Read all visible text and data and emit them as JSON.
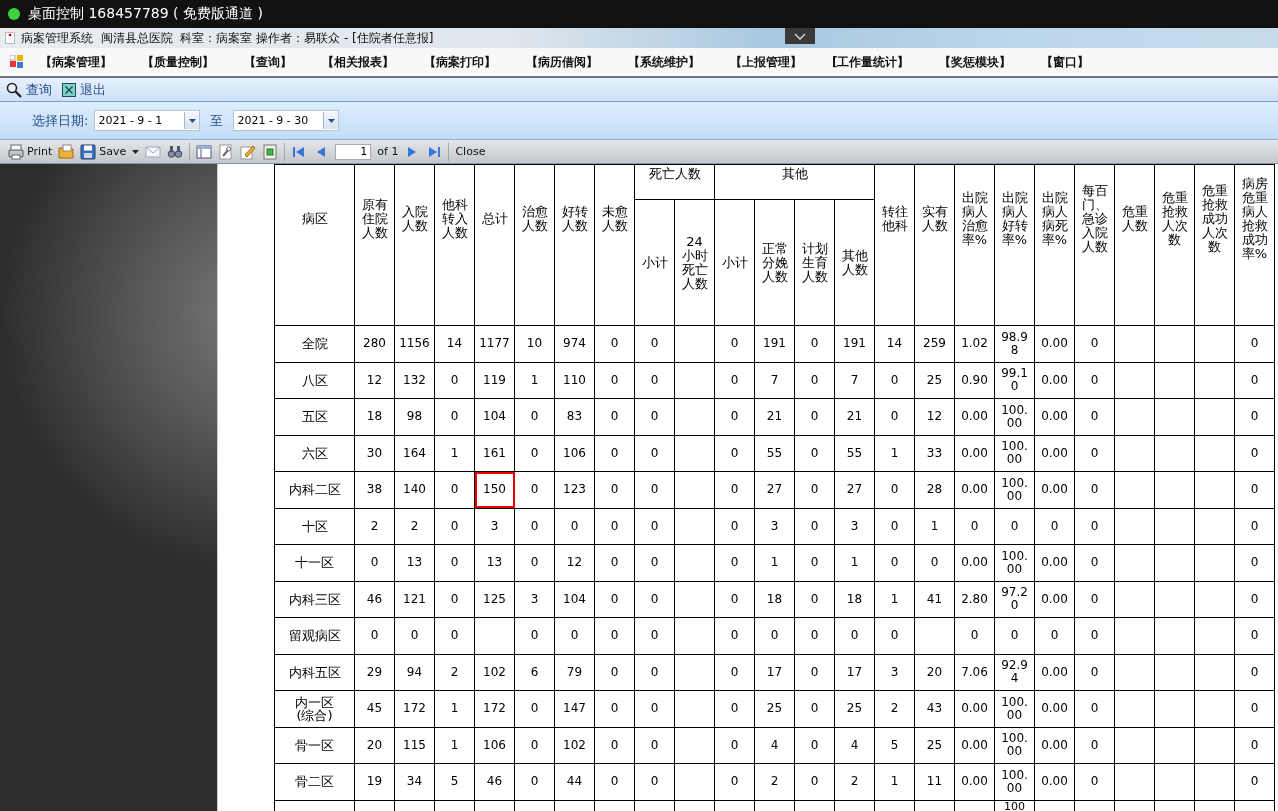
{
  "remote_title": "桌面控制 168457789 ( 免费版通道 )",
  "app_title": "病案管理系统  闽清县总医院  科室：病案室 操作者：易联众 - [住院者任意报]",
  "menu": [
    "【病案管理】",
    "【质量控制】",
    "【查询】",
    "【相关报表】",
    "【病案打印】",
    "【病历借阅】",
    "【系统维护】",
    "【上报管理】",
    "[工作量统计】",
    "【奖惩模块】",
    "【窗口】"
  ],
  "toolbar": [
    {
      "kind": "search",
      "label": "查询"
    },
    {
      "kind": "exit",
      "label": "退出"
    }
  ],
  "date_filter": {
    "label": "选择日期:",
    "from": "2021 - 9 - 1",
    "separator": "至",
    "to": "2021 - 9 - 30"
  },
  "report_toolbar": [
    {
      "kind": "print",
      "label": "Print"
    },
    {
      "kind": "open"
    },
    {
      "kind": "save",
      "label": "Save"
    },
    {
      "kind": "dropdown"
    },
    {
      "kind": "mail"
    },
    {
      "kind": "find"
    },
    {
      "kind": "separator"
    },
    {
      "kind": "layout"
    },
    {
      "kind": "setup"
    },
    {
      "kind": "edit"
    },
    {
      "kind": "export"
    },
    {
      "kind": "separator"
    },
    {
      "kind": "first"
    },
    {
      "kind": "prev"
    },
    {
      "kind": "page",
      "value": "1",
      "total": "of 1"
    },
    {
      "kind": "next"
    },
    {
      "kind": "last"
    },
    {
      "kind": "separator"
    },
    {
      "kind": "close",
      "label": "Close"
    }
  ],
  "table": {
    "header": [
      {
        "label": "病区"
      },
      {
        "label": "原有住院人数"
      },
      {
        "label": "入院人数"
      },
      {
        "label": "他科转入人数"
      },
      {
        "label": "总计"
      },
      {
        "label": "治愈人数"
      },
      {
        "label": "好转人数"
      },
      {
        "label": "未愈人数"
      },
      {
        "label": "死亡人数",
        "children": [
          {
            "label": "小计"
          },
          {
            "label": "24小时死亡人数"
          }
        ]
      },
      {
        "label": "其他",
        "children": [
          {
            "label": "小计"
          },
          {
            "label": "正常分娩人数"
          },
          {
            "label": "计划生育人数"
          },
          {
            "label": "其他人数"
          }
        ]
      },
      {
        "label": "转往他科"
      },
      {
        "label": "实有人数"
      },
      {
        "label": "出院病人治愈率%"
      },
      {
        "label": "出院病人好转率%"
      },
      {
        "label": "出院病人病死率%"
      },
      {
        "label": "每百门、急诊入院人数"
      },
      {
        "label": "危重人数"
      },
      {
        "label": "危重抢救人次数"
      },
      {
        "label": "危重抢救成功人次数"
      },
      {
        "label": "病房危重病人抢救成功率%"
      }
    ],
    "rows": [
      {
        "ward": "全院",
        "cells": [
          "280",
          "1156",
          "14",
          "1177",
          "10",
          "974",
          "0",
          "0",
          null,
          "0",
          "191",
          "0",
          "191",
          "14",
          "259",
          "1.02",
          "98.98",
          "0.00",
          "0",
          null,
          null,
          null,
          "0"
        ]
      },
      {
        "ward": "八区",
        "cells": [
          "12",
          "132",
          "0",
          "119",
          "1",
          "110",
          "0",
          "0",
          null,
          "0",
          "7",
          "0",
          "7",
          "0",
          "25",
          "0.90",
          "99.10",
          "0.00",
          "0",
          null,
          null,
          null,
          "0"
        ]
      },
      {
        "ward": "五区",
        "cells": [
          "18",
          "98",
          "0",
          "104",
          "0",
          "83",
          "0",
          "0",
          null,
          "0",
          "21",
          "0",
          "21",
          "0",
          "12",
          "0.00",
          "100.00",
          "0.00",
          "0",
          null,
          null,
          null,
          "0"
        ]
      },
      {
        "ward": "六区",
        "cells": [
          "30",
          "164",
          "1",
          "161",
          "0",
          "106",
          "0",
          "0",
          null,
          "0",
          "55",
          "0",
          "55",
          "1",
          "33",
          "0.00",
          "100.00",
          "0.00",
          "0",
          null,
          null,
          null,
          "0"
        ]
      },
      {
        "ward": "内科二区",
        "cells": [
          "38",
          "140",
          "0",
          {
            "text": "150",
            "selected": true
          },
          "0",
          "123",
          "0",
          "0",
          null,
          "0",
          "27",
          "0",
          "27",
          "0",
          "28",
          "0.00",
          "100.00",
          "0.00",
          "0",
          null,
          null,
          null,
          "0"
        ]
      },
      {
        "ward": "十区",
        "cells": [
          "2",
          "2",
          "0",
          "3",
          "0",
          "0",
          "0",
          "0",
          null,
          "0",
          "3",
          "0",
          "3",
          "0",
          "1",
          "0",
          "0",
          "0",
          "0",
          null,
          null,
          null,
          "0"
        ]
      },
      {
        "ward": "十一区",
        "cells": [
          "0",
          "13",
          "0",
          "13",
          "0",
          "12",
          "0",
          "0",
          null,
          "0",
          "1",
          "0",
          "1",
          "0",
          "0",
          "0.00",
          "100.00",
          "0.00",
          "0",
          null,
          null,
          null,
          "0"
        ]
      },
      {
        "ward": "内科三区",
        "cells": [
          "46",
          "121",
          "0",
          "125",
          "3",
          "104",
          "0",
          "0",
          null,
          "0",
          "18",
          "0",
          "18",
          "1",
          "41",
          "2.80",
          "97.20",
          "0.00",
          "0",
          null,
          null,
          null,
          "0"
        ]
      },
      {
        "ward": "留观病区",
        "cells": [
          "0",
          "0",
          "0",
          null,
          "0",
          "0",
          "0",
          "0",
          null,
          "0",
          "0",
          "0",
          "0",
          "0",
          null,
          "0",
          "0",
          "0",
          "0",
          null,
          null,
          null,
          "0"
        ]
      },
      {
        "ward": "内科五区",
        "cells": [
          "29",
          "94",
          "2",
          "102",
          "6",
          "79",
          "0",
          "0",
          null,
          "0",
          "17",
          "0",
          "17",
          "3",
          "20",
          "7.06",
          "92.94",
          "0.00",
          "0",
          null,
          null,
          null,
          "0"
        ]
      },
      {
        "ward": "内一区\n(综合)",
        "cells": [
          "45",
          "172",
          "1",
          "172",
          "0",
          "147",
          "0",
          "0",
          null,
          "0",
          "25",
          "0",
          "25",
          "2",
          "43",
          "0.00",
          "100.00",
          "0.00",
          "0",
          null,
          null,
          null,
          "0"
        ]
      },
      {
        "ward": "骨一区",
        "cells": [
          "20",
          "115",
          "1",
          "106",
          "0",
          "102",
          "0",
          "0",
          null,
          "0",
          "4",
          "0",
          "4",
          "5",
          "25",
          "0.00",
          "100.00",
          "0.00",
          "0",
          null,
          null,
          null,
          "0"
        ]
      },
      {
        "ward": "骨二区",
        "cells": [
          "19",
          "34",
          "5",
          "46",
          "0",
          "44",
          "0",
          "0",
          null,
          "0",
          "2",
          "0",
          "2",
          "1",
          "11",
          "0.00",
          "100.00",
          "0.00",
          "0",
          null,
          null,
          null,
          "0"
        ]
      },
      {
        "cells": [
          null,
          null,
          null,
          null,
          null,
          null,
          null,
          null,
          null,
          null,
          null,
          null,
          null,
          null,
          null,
          null,
          "100",
          null,
          null,
          null,
          null,
          null,
          null
        ]
      }
    ]
  }
}
